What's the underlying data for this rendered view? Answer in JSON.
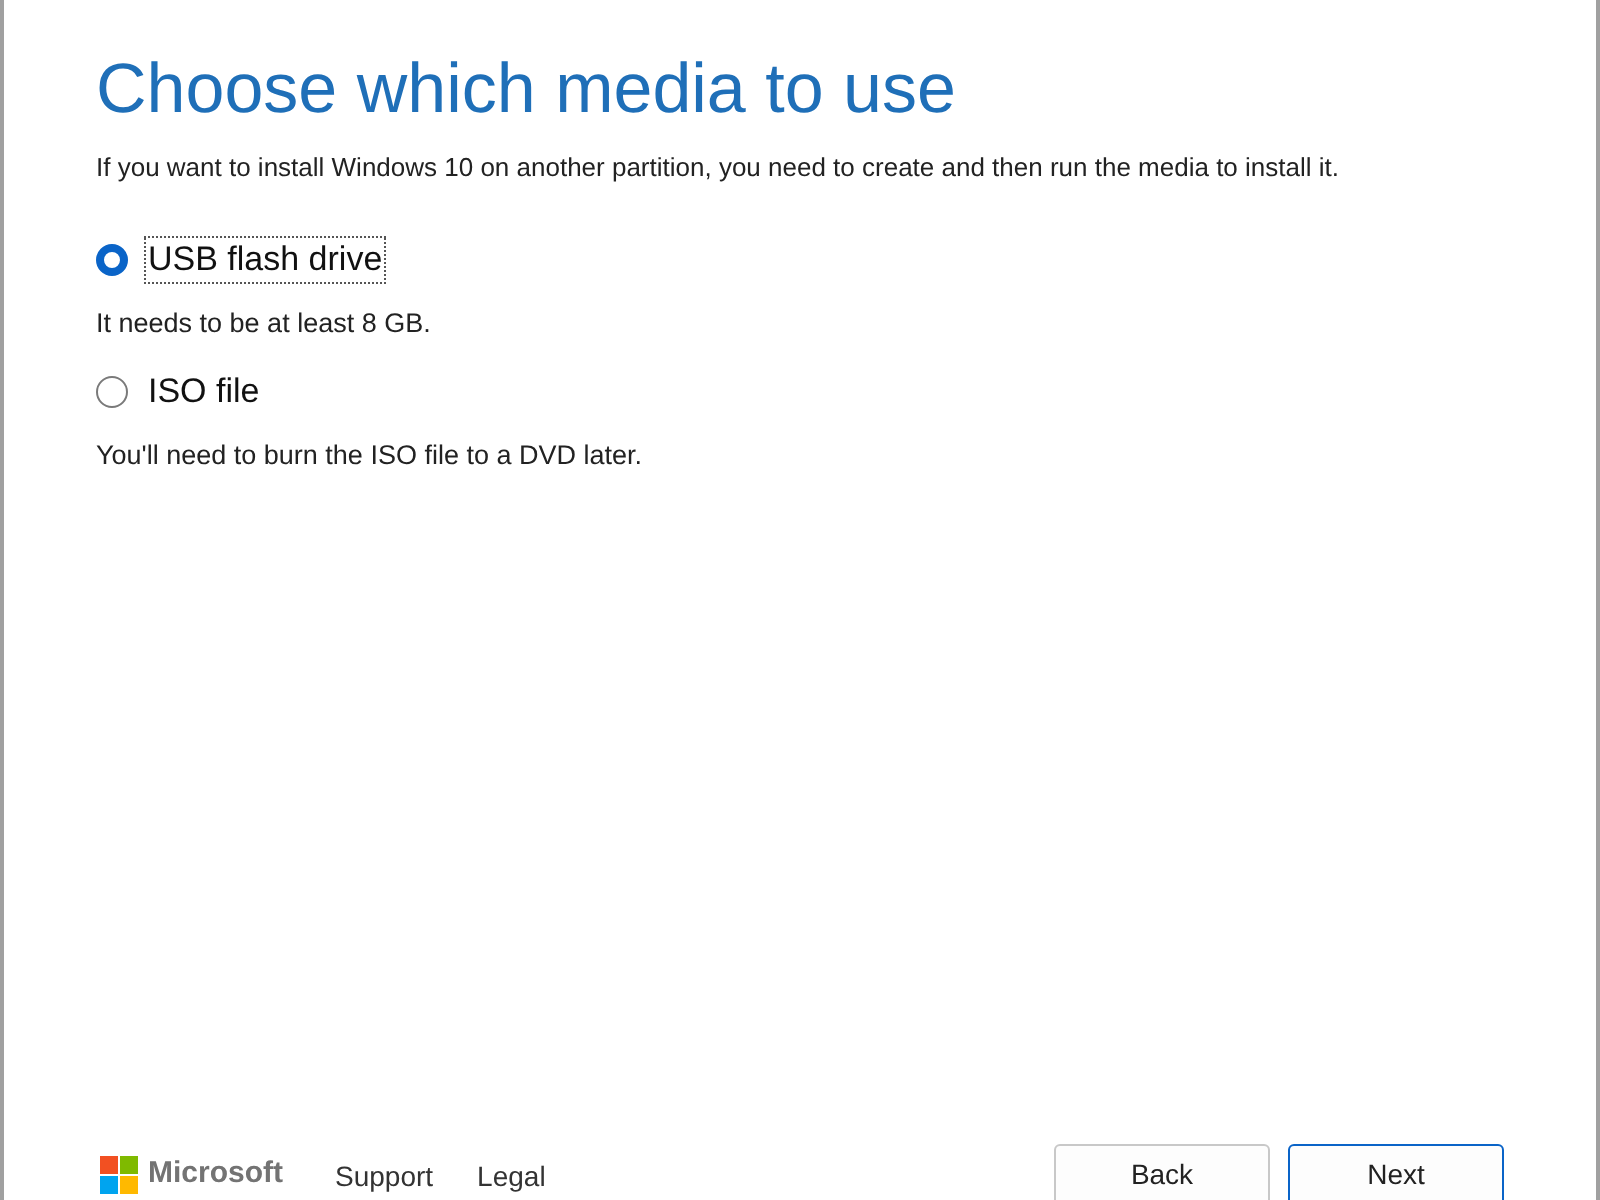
{
  "title": "Choose which media to use",
  "description": "If you want to install Windows 10 on another partition, you need to create and then run the media to install it.",
  "options": [
    {
      "label": "USB flash drive",
      "hint": "It needs to be at least 8 GB.",
      "selected": true
    },
    {
      "label": "ISO file",
      "hint": "You'll need to burn the ISO file to a DVD later.",
      "selected": false
    }
  ],
  "footer": {
    "brand": "Microsoft",
    "links": [
      "Support",
      "Legal"
    ]
  },
  "buttons": [
    {
      "label": "Back",
      "kind": "secondary"
    },
    {
      "label": "Next",
      "kind": "primary"
    }
  ]
}
